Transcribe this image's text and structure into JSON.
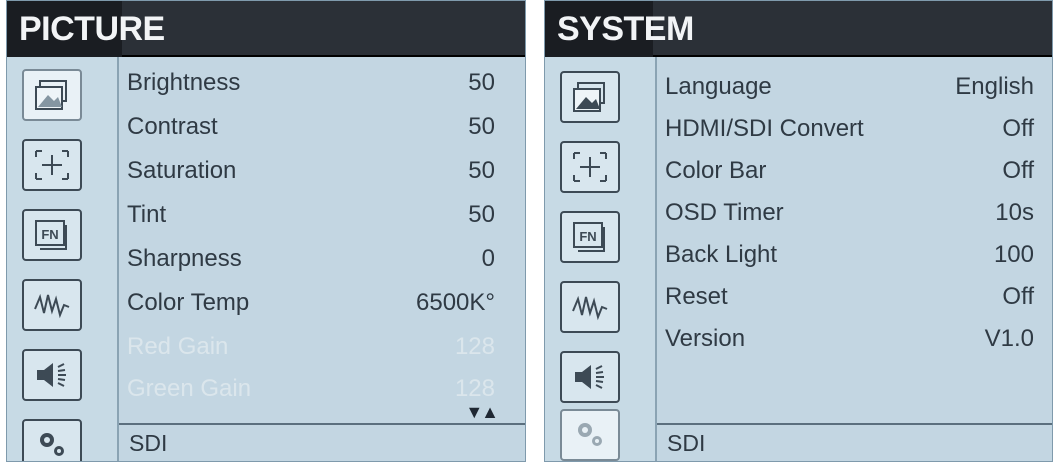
{
  "picture_panel": {
    "title": "PICTURE",
    "rows": [
      {
        "label": "Brightness",
        "value": "50"
      },
      {
        "label": "Contrast",
        "value": "50"
      },
      {
        "label": "Saturation",
        "value": "50"
      },
      {
        "label": "Tint",
        "value": "50"
      },
      {
        "label": "Sharpness",
        "value": "0"
      },
      {
        "label": "Color Temp",
        "value": "6500K°"
      },
      {
        "label": "Red Gain",
        "value": "128"
      },
      {
        "label": "Green Gain",
        "value": "128"
      }
    ],
    "scroll_indicator": "▼▲",
    "footer": "SDI",
    "active_icon": "picture-icon"
  },
  "system_panel": {
    "title": "SYSTEM",
    "rows": [
      {
        "label": "Language",
        "value": "English"
      },
      {
        "label": "HDMI/SDI Convert",
        "value": "Off"
      },
      {
        "label": "Color Bar",
        "value": "Off"
      },
      {
        "label": "OSD Timer",
        "value": "10s"
      },
      {
        "label": "Back Light",
        "value": "100"
      },
      {
        "label": "Reset",
        "value": "Off"
      },
      {
        "label": "Version",
        "value": "V1.0"
      }
    ],
    "footer": "SDI",
    "active_icon": "settings-icon"
  },
  "sidebar_icons": [
    "picture-icon",
    "marker-icon",
    "function-icon",
    "waveform-icon",
    "audio-icon",
    "settings-icon"
  ],
  "colors": {
    "panel_bg": "#c3d6e2",
    "title_bar": "#2b3037",
    "text": "#2f3a44",
    "disabled_text": "#dbe6ec"
  }
}
